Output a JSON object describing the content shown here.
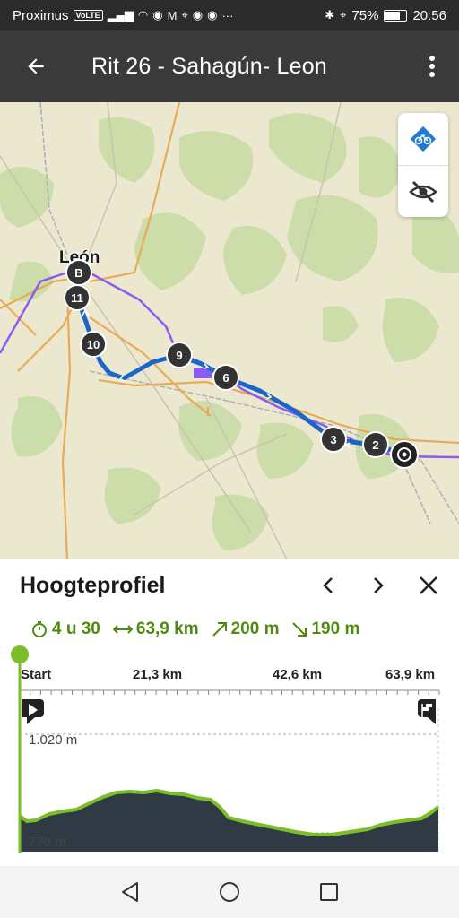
{
  "status_bar": {
    "carrier": "Proximus",
    "volte": "VoLTE",
    "battery_percent": "75%",
    "battery_level": 0.75,
    "time": "20:56"
  },
  "app_bar": {
    "title": "Rit 26 - Sahagún- Leon"
  },
  "map": {
    "city_label": "León",
    "start_marker": "B",
    "waypoints": [
      "11",
      "10",
      "9",
      "6",
      "3",
      "2"
    ],
    "route_color": "#1a66c9",
    "line_color": "#8a5cf0"
  },
  "profile": {
    "title": "Hoogteprofiel",
    "duration": "4 u 30",
    "distance": "63,9 km",
    "ascent": "200 m",
    "descent": "190 m",
    "axis_ticks": [
      "Start",
      "21,3 km",
      "42,6 km",
      "63,9 km"
    ],
    "elevation_max": "1.020 m",
    "elevation_min": "770 m",
    "accent": "#4f8a10",
    "fill": "#2f3a44"
  }
}
